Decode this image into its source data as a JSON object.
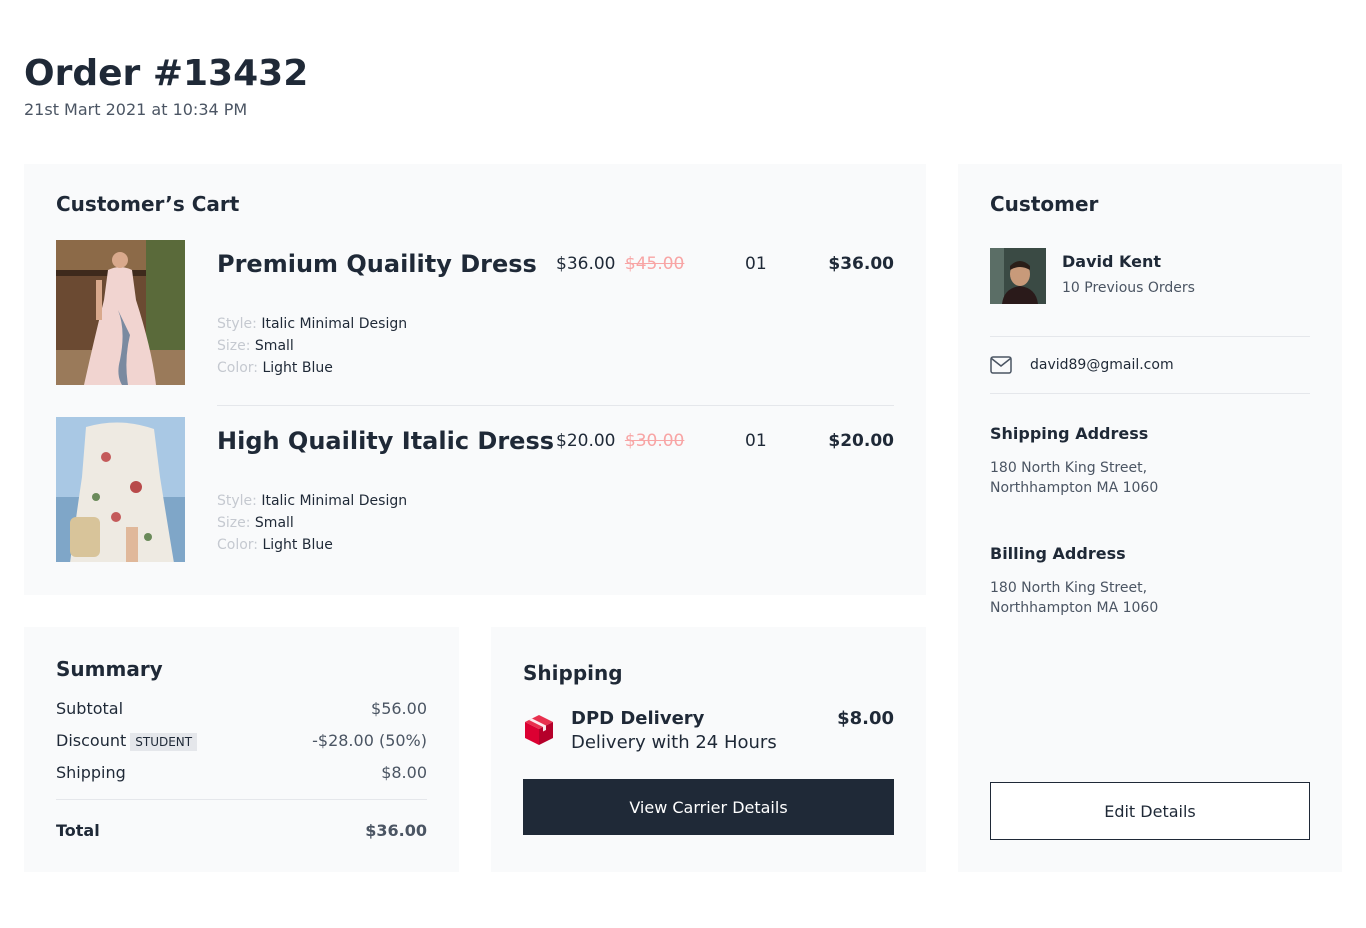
{
  "order": {
    "title": "Order #13432",
    "date": "21st Mart 2021 at 10:34 PM"
  },
  "cart": {
    "title": "Customer’s Cart",
    "items": [
      {
        "name": "Premium Quaility Dress",
        "price": "$36.00",
        "old_price": "$45.00",
        "qty": "01",
        "total": "$36.00",
        "style_label": "Style:",
        "style": "Italic Minimal Design",
        "size_label": "Size:",
        "size": "Small",
        "color_label": "Color:",
        "color": "Light Blue"
      },
      {
        "name": "High Quaility Italic Dress",
        "price": "$20.00",
        "old_price": "$30.00",
        "qty": "01",
        "total": "$20.00",
        "style_label": "Style:",
        "style": "Italic Minimal Design",
        "size_label": "Size:",
        "size": "Small",
        "color_label": "Color:",
        "color": "Light Blue"
      }
    ]
  },
  "summary": {
    "title": "Summary",
    "subtotal_label": "Subtotal",
    "subtotal": "$56.00",
    "discount_label": "Discount",
    "discount_badge": "STUDENT",
    "discount": "-$28.00 (50%)",
    "shipping_label": "Shipping",
    "shipping": "$8.00",
    "total_label": "Total",
    "total": "$36.00"
  },
  "shipping": {
    "title": "Shipping",
    "carrier": "DPD Delivery",
    "description": "Delivery with 24 Hours",
    "price": "$8.00",
    "button": "View Carrier Details"
  },
  "customer": {
    "title": "Customer",
    "name": "David Kent",
    "orders": "10 Previous Orders",
    "email": "david89@gmail.com",
    "shipping_title": "Shipping Address",
    "shipping_line1": "180 North King Street,",
    "shipping_line2": "Northhampton MA 1060",
    "billing_title": "Billing Address",
    "billing_line1": "180 North King Street,",
    "billing_line2": "Northhampton MA 1060",
    "button": "Edit Details"
  },
  "colors": {
    "dark": "#1f2937",
    "panel": "#f9fafb",
    "strike": "#f8a5a5",
    "dpd_red": "#dc0032"
  },
  "icons": [
    "dress-photo",
    "dress-photo",
    "avatar-photo",
    "mail-icon",
    "dpd-box-icon"
  ]
}
